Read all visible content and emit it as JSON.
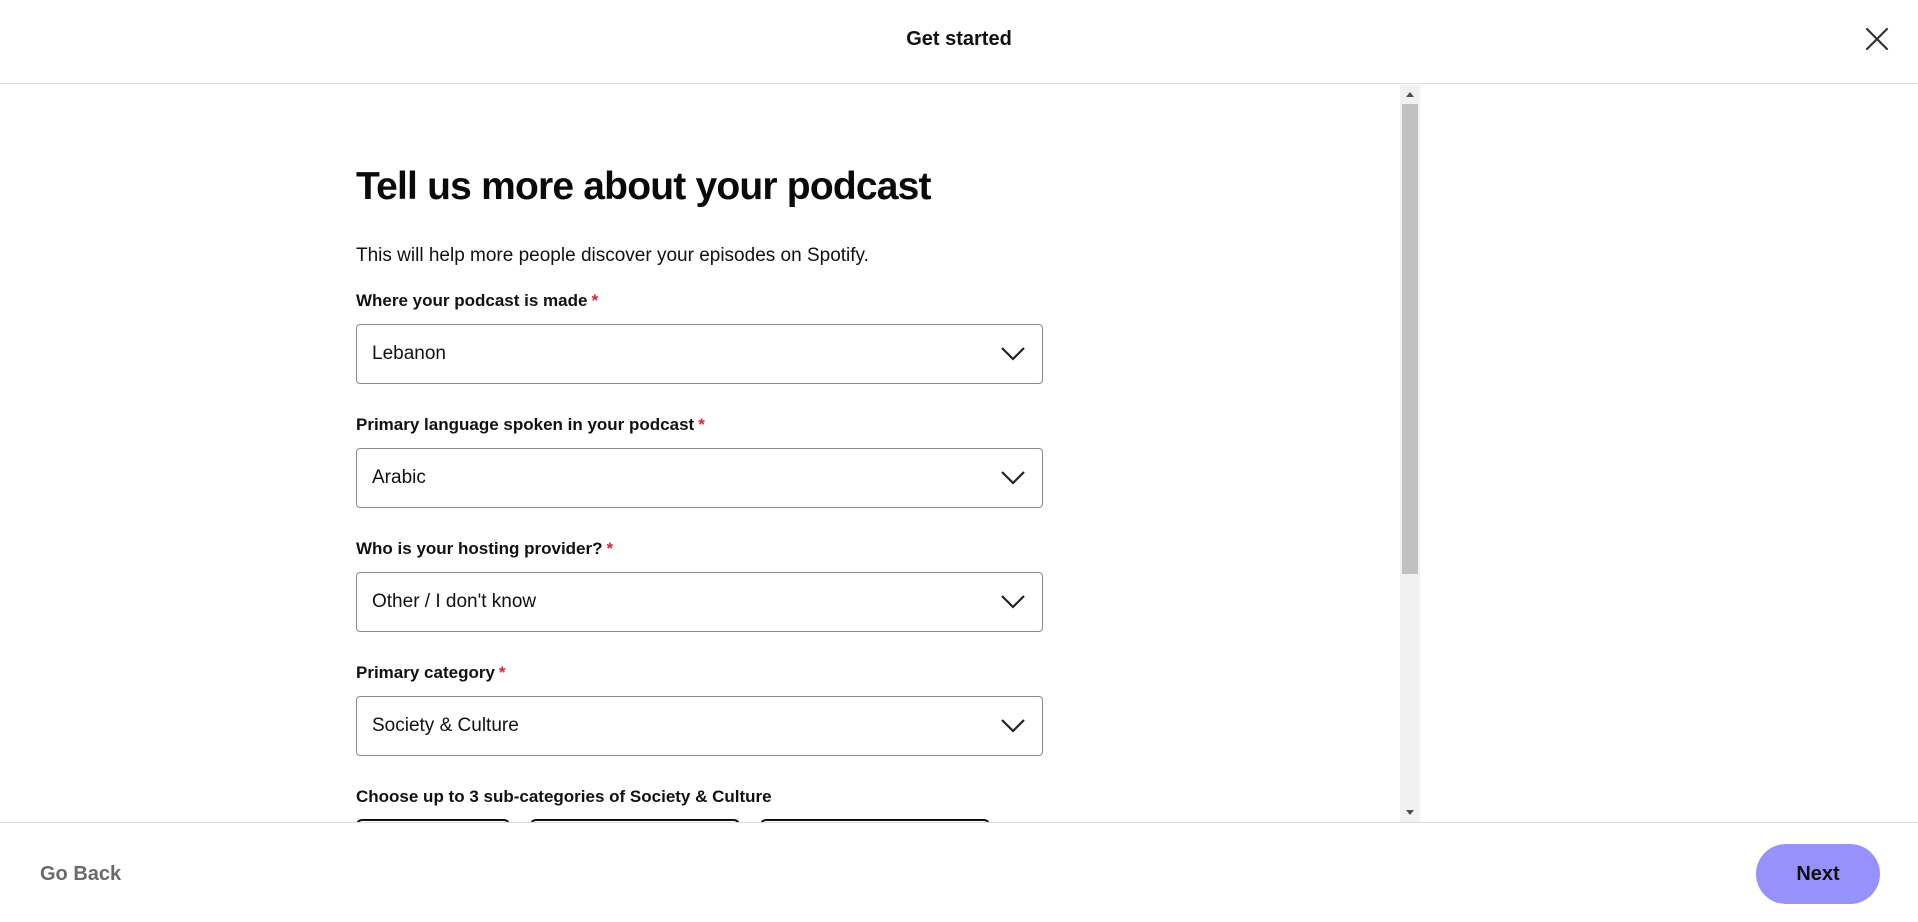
{
  "header": {
    "title": "Get started",
    "close_icon": "close-icon"
  },
  "main": {
    "heading": "Tell us more about your podcast",
    "intro": "This will help more people discover your episodes on Spotify.",
    "required_marker": "*",
    "fields": [
      {
        "label": "Where your podcast is made",
        "value": "Lebanon"
      },
      {
        "label": "Primary language spoken in your podcast",
        "value": "Arabic"
      },
      {
        "label": "Who is your hosting provider?",
        "value": "Other / I don't know"
      },
      {
        "label": "Primary category",
        "value": "Society & Culture"
      }
    ],
    "subcategories_label": "Choose up to 3 sub-categories of Society & Culture",
    "chevron_icon": "chevron-down-icon"
  },
  "footer": {
    "back_label": "Go Back",
    "next_label": "Next",
    "next_color": "#9691fb"
  },
  "colors": {
    "required": "#e22134",
    "border": "#8a8a8a"
  }
}
